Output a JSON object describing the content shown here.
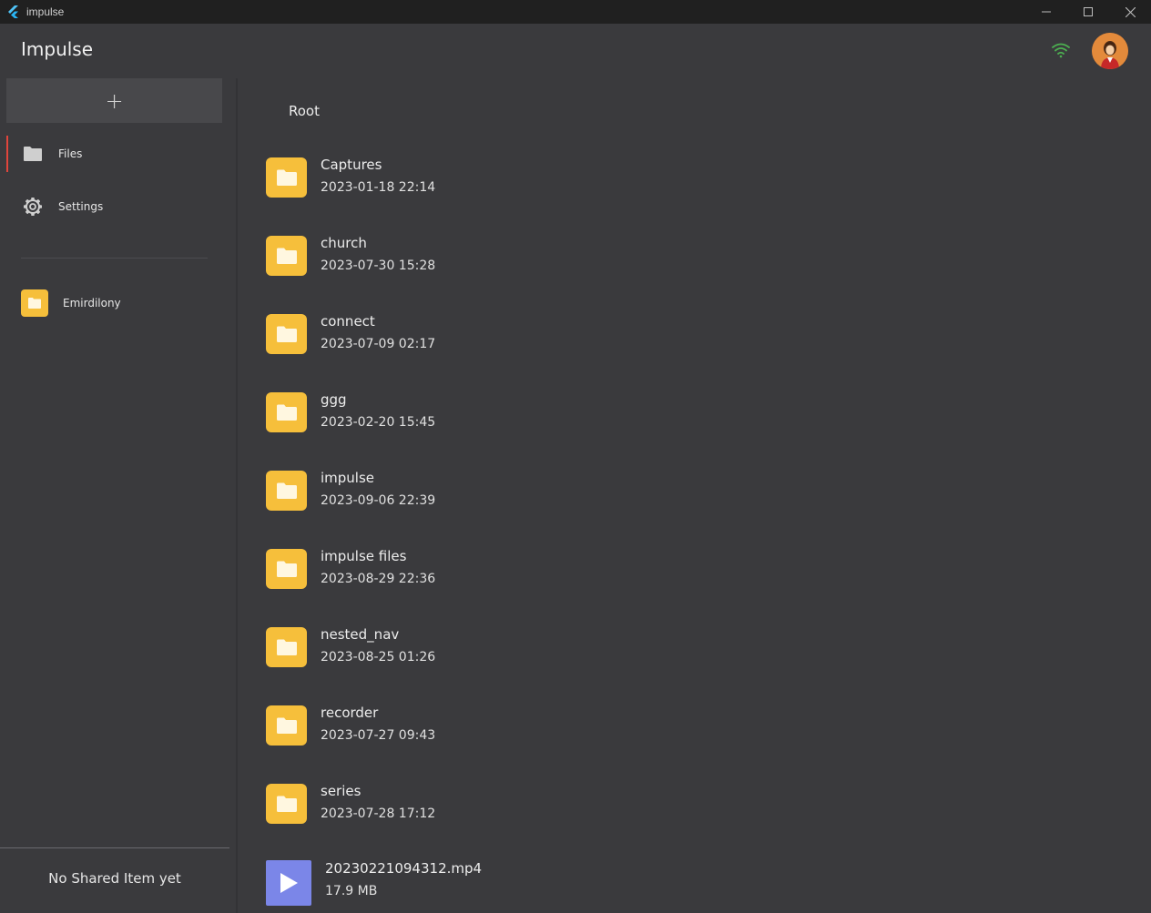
{
  "window": {
    "title": "impulse",
    "controls": [
      "minimize-icon",
      "maximize-icon",
      "close-icon"
    ]
  },
  "header": {
    "app_title": "Impulse",
    "status_icon": "wifi-icon",
    "status_color": "#4caf50",
    "avatar_color": "#e07b2e"
  },
  "sidebar": {
    "add_label": "+",
    "nav": [
      {
        "label": "Files",
        "icon": "folder-icon",
        "active": true
      },
      {
        "label": "Settings",
        "icon": "gear-icon",
        "active": false
      }
    ],
    "shared_users": [
      {
        "label": "Emirdilony",
        "icon": "folder-icon"
      }
    ],
    "empty_shared_text": "No Shared Item yet",
    "accent_color": "#e0453c"
  },
  "main": {
    "breadcrumb": "Root",
    "items": [
      {
        "name": "Captures",
        "meta": "2023-01-18 22:14",
        "type": "folder"
      },
      {
        "name": "church",
        "meta": "2023-07-30 15:28",
        "type": "folder"
      },
      {
        "name": "connect",
        "meta": "2023-07-09 02:17",
        "type": "folder"
      },
      {
        "name": "ggg",
        "meta": "2023-02-20 15:45",
        "type": "folder"
      },
      {
        "name": "impulse",
        "meta": "2023-09-06 22:39",
        "type": "folder"
      },
      {
        "name": "impulse files",
        "meta": "2023-08-29 22:36",
        "type": "folder"
      },
      {
        "name": "nested_nav",
        "meta": "2023-08-25 01:26",
        "type": "folder"
      },
      {
        "name": "recorder",
        "meta": "2023-07-27 09:43",
        "type": "folder"
      },
      {
        "name": "series",
        "meta": "2023-07-28 17:12",
        "type": "folder"
      },
      {
        "name": "20230221094312.mp4",
        "meta": "17.9 MB",
        "type": "video"
      }
    ],
    "folder_color": "#f6bf3b",
    "video_color": "#7b86e8"
  }
}
